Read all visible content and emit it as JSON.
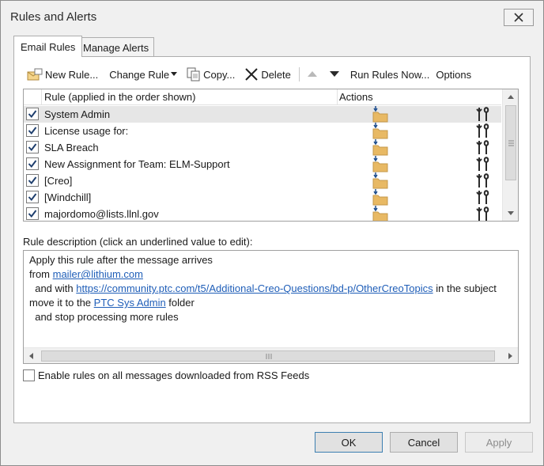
{
  "window": {
    "title": "Rules and Alerts"
  },
  "tabs": [
    {
      "label": "Email Rules",
      "active": true
    },
    {
      "label": "Manage Alerts",
      "active": false
    }
  ],
  "toolbar": {
    "new_rule": "New Rule...",
    "change_rule": "Change Rule",
    "copy": "Copy...",
    "delete": "Delete",
    "run_rules_now": "Run Rules Now...",
    "options": "Options"
  },
  "rules_list": {
    "col_rule": "Rule (applied in the order shown)",
    "col_actions": "Actions",
    "rows": [
      {
        "name": "System Admin",
        "checked": true,
        "selected": true
      },
      {
        "name": "License usage for:",
        "checked": true,
        "selected": false
      },
      {
        "name": "SLA Breach",
        "checked": true,
        "selected": false
      },
      {
        "name": "New Assignment for Team: ELM-Support",
        "checked": true,
        "selected": false
      },
      {
        "name": "[Creo]",
        "checked": true,
        "selected": false
      },
      {
        "name": "[Windchill]",
        "checked": true,
        "selected": false
      },
      {
        "name": "majordomo@lists.llnl.gov",
        "checked": true,
        "selected": false
      }
    ]
  },
  "description": {
    "label": "Rule description (click an underlined value to edit):",
    "line1": "Apply this rule after the message arrives",
    "line2_prefix": "from ",
    "line2_link": "mailer@lithium.com",
    "line3_prefix": "  and with ",
    "line3_link": "https://community.ptc.com/t5/Additional-Creo-Questions/bd-p/OtherCreoTopics",
    "line3_suffix": " in the subject",
    "line4_prefix": "move it to the ",
    "line4_link": "PTC Sys Admin",
    "line4_suffix": " folder",
    "line5": "  and stop processing more rules"
  },
  "rss_option": {
    "label": "Enable rules on all messages downloaded from RSS Feeds",
    "checked": false
  },
  "buttons": {
    "ok": "OK",
    "cancel": "Cancel",
    "apply": "Apply"
  },
  "colors": {
    "link": "#1f5eb8",
    "folder": "#e8b964",
    "selected_row": "#e6e6e6"
  }
}
